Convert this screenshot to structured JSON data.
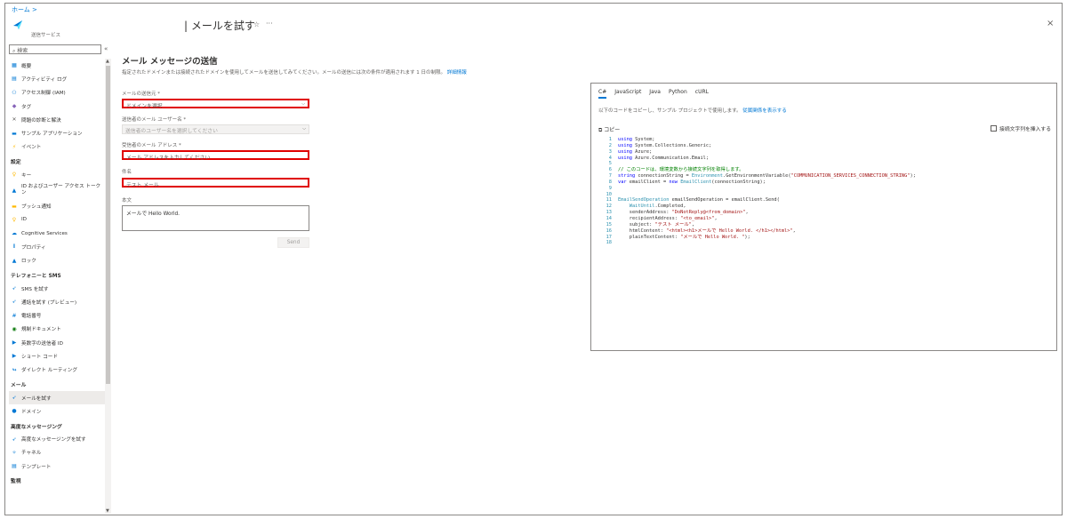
{
  "breadcrumb": "ホーム >",
  "service_name": "送信サービス",
  "page_title": "| メールを試す",
  "close_label": "×",
  "sidebar": {
    "search_placeholder": "検索",
    "collapse": "«",
    "items": [
      {
        "type": "item",
        "label": "概要",
        "icon": "overview-icon",
        "glyph": "▦",
        "color": "#0078d4"
      },
      {
        "type": "item",
        "label": "アクティビティ ログ",
        "icon": "activity-log-icon",
        "glyph": "▤",
        "color": "#0078d4"
      },
      {
        "type": "item",
        "label": "アクセス制御 (IAM)",
        "icon": "iam-icon",
        "glyph": "⚇",
        "color": "#0078d4"
      },
      {
        "type": "item",
        "label": "タグ",
        "icon": "tag-icon",
        "glyph": "◆",
        "color": "#8764b8"
      },
      {
        "type": "item",
        "label": "問題の診断と解決",
        "icon": "diagnose-icon",
        "glyph": "✕",
        "color": "#605e5c"
      },
      {
        "type": "item",
        "label": "サンプル アプリケーション",
        "icon": "sample-app-icon",
        "glyph": "▬",
        "color": "#0078d4"
      },
      {
        "type": "item",
        "label": "イベント",
        "icon": "event-icon",
        "glyph": "⚡",
        "color": "#ffb900"
      },
      {
        "type": "section",
        "label": "設定"
      },
      {
        "type": "item",
        "label": "キー",
        "icon": "key-icon",
        "glyph": "♀",
        "color": "#ffb900"
      },
      {
        "type": "item2",
        "label": "ID およびユーザー アクセス トークン",
        "icon": "identity-icon",
        "glyph": "▲",
        "color": "#0078d4"
      },
      {
        "type": "item",
        "label": "プッシュ通知",
        "icon": "push-icon",
        "glyph": "▬",
        "color": "#ffb900"
      },
      {
        "type": "item",
        "label": "ID",
        "icon": "id-icon",
        "glyph": "♀",
        "color": "#ffb900"
      },
      {
        "type": "item",
        "label": "Cognitive Services",
        "icon": "cognitive-icon",
        "glyph": "☁",
        "color": "#0078d4"
      },
      {
        "type": "item",
        "label": "プロパティ",
        "icon": "properties-icon",
        "glyph": "⦀",
        "color": "#0078d4"
      },
      {
        "type": "item",
        "label": "ロック",
        "icon": "lock-icon",
        "glyph": "▲",
        "color": "#0078d4"
      },
      {
        "type": "section",
        "label": "テレフォニーと SMS"
      },
      {
        "type": "item",
        "label": "SMS を試す",
        "icon": "sms-icon",
        "glyph": "➶",
        "color": "#0078d4"
      },
      {
        "type": "item",
        "label": "通話を試す (プレビュー)",
        "icon": "call-icon",
        "glyph": "➶",
        "color": "#0078d4"
      },
      {
        "type": "item",
        "label": "電話番号",
        "icon": "phone-icon",
        "glyph": "#",
        "color": "#0078d4"
      },
      {
        "type": "item",
        "label": "規制ドキュメント",
        "icon": "regulatory-icon",
        "glyph": "◉",
        "color": "#107c10"
      },
      {
        "type": "item",
        "label": "英数字の送信者 ID",
        "icon": "sender-id-icon",
        "glyph": "▶",
        "color": "#0078d4"
      },
      {
        "type": "item",
        "label": "ショート コード",
        "icon": "short-code-icon",
        "glyph": "▶",
        "color": "#0078d4"
      },
      {
        "type": "item",
        "label": "ダイレクト ルーティング",
        "icon": "routing-icon",
        "glyph": "↬",
        "color": "#0078d4"
      },
      {
        "type": "section",
        "label": "メール"
      },
      {
        "type": "item",
        "label": "メールを試す",
        "icon": "email-icon",
        "glyph": "➶",
        "color": "#0078d4",
        "active": true
      },
      {
        "type": "item",
        "label": "ドメイン",
        "icon": "domain-icon",
        "glyph": "●",
        "color": "#0078d4"
      },
      {
        "type": "section",
        "label": "高度なメッセージング"
      },
      {
        "type": "item",
        "label": "高度なメッセージングを試す",
        "icon": "advanced-msg-icon",
        "glyph": "➶",
        "color": "#0078d4"
      },
      {
        "type": "item",
        "label": "チャネル",
        "icon": "channel-icon",
        "glyph": "✧",
        "color": "#0078d4"
      },
      {
        "type": "item",
        "label": "テンプレート",
        "icon": "template-icon",
        "glyph": "▤",
        "color": "#0078d4"
      },
      {
        "type": "section",
        "label": "監視"
      }
    ]
  },
  "main": {
    "heading": "メール メッセージの送信",
    "description": "指定されたドメインまたは接続されたドメインを使用してメールを送信してみてください。メールの送信には次の条件が適用されます 1 日の制限。",
    "description_link": "詳細情報",
    "sender_label": "メールの送信元 *",
    "sender_placeholder": "ドメインを選択",
    "sender_user_label": "送信者のメール ユーザー名 *",
    "sender_user_placeholder": "送信者のユーザー名を選択してください",
    "recipient_label": "受信者のメール アドレス *",
    "recipient_placeholder": "メール アドレスを入力してください",
    "subject_label": "件名",
    "subject_value": "テスト メール",
    "body_label": "本文",
    "body_value": "メールで Hello World.",
    "send_label": "Send"
  },
  "code_panel": {
    "tabs": [
      "C#",
      "JavaScript",
      "Java",
      "Python",
      "cURL"
    ],
    "active_tab": "C#",
    "description": "以下のコードをコピーし、サンプル プロジェクトで使用します。",
    "description_link": "従属関係を表示する",
    "copy_label": "コピー",
    "insert_label": "接続文字列を挿入する",
    "lines": [
      "using System;",
      "using System.Collections.Generic;",
      "using Azure;",
      "using Azure.Communication.Email;",
      "",
      "// このコードは、環境変数から接続文字列を取得します。",
      "string connectionString = Environment.GetEnvironmentVariable(\"COMMUNICATION_SERVICES_CONNECTION_STRING\");",
      "var emailClient = new EmailClient(connectionString);",
      "",
      "",
      "EmailSendOperation emailSendOperation = emailClient.Send(",
      "    WaitUntil.Completed,",
      "    senderAddress: \"DoNotReply@<from_domain>\",",
      "    recipientAddress: \"<to_email>\",",
      "    subject: \"テスト メール\",",
      "    htmlContent: \"<html><h1>メールで Hello World. </h1></html>\",",
      "    plainTextContent: \"メールで Hello World. \");",
      ""
    ]
  }
}
